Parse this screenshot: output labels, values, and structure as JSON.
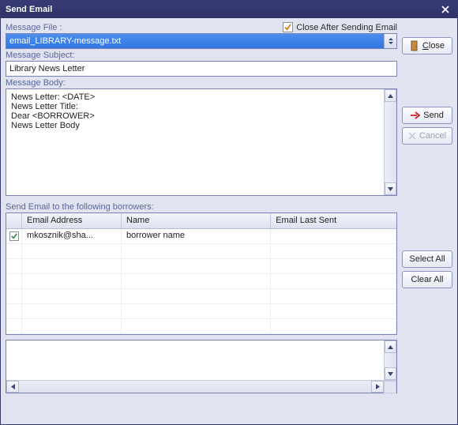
{
  "window": {
    "title": "Send Email"
  },
  "labels": {
    "message_file": "Message File :",
    "close_after": "Close After Sending Email",
    "message_subject": "Message Subject:",
    "message_body": "Message Body:",
    "recipients": "Send Email to the following borrowers:"
  },
  "fields": {
    "message_file_value": "email_LIBRARY-message.txt",
    "subject_value": "Library News Letter",
    "body_value": "News Letter: <DATE>\nNews Letter Title:\nDear <BORROWER>\nNews Letter Body",
    "close_after_checked": true
  },
  "table": {
    "headers": {
      "email": "Email Address",
      "name": "Name",
      "last_sent": "Email Last Sent"
    },
    "rows": [
      {
        "checked": true,
        "email": "mkosznik@sha...",
        "name": "borrower name",
        "last_sent": ""
      }
    ]
  },
  "buttons": {
    "close": "Close",
    "send": "Send",
    "cancel": "Cancel",
    "select_all": "Select All",
    "clear_all": "Clear All"
  }
}
